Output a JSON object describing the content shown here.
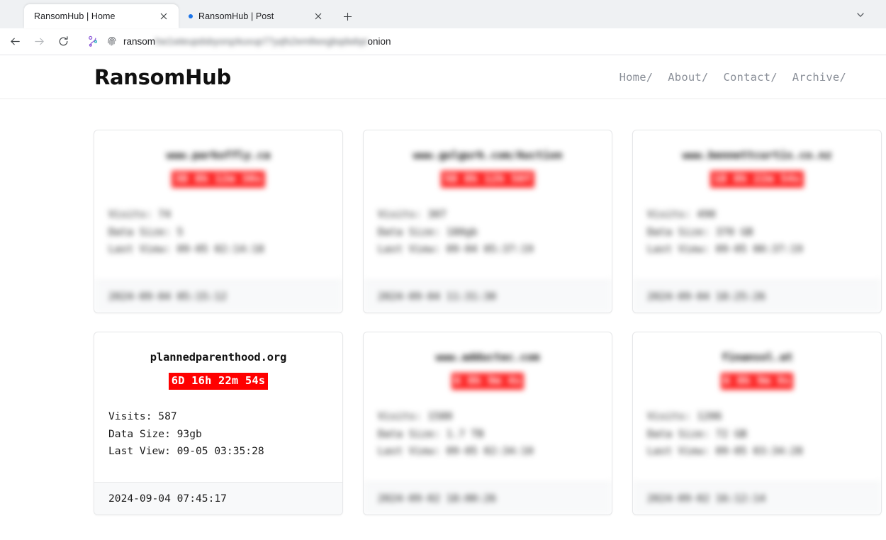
{
  "browser": {
    "tabs": [
      {
        "title": "RansomHub | Home",
        "active": true,
        "has_dot": false,
        "close_icon": "close-icon"
      },
      {
        "title": "RansomHub | Post",
        "active": false,
        "has_dot": true,
        "close_icon": "close-icon"
      }
    ],
    "new_tab_label": "+",
    "tab_list_icon": "chevron-down-icon",
    "toolbar": {
      "back_icon": "back-arrow-icon",
      "forward_icon": "forward-arrow-icon",
      "reload_icon": "reload-icon",
      "split_screen_icon": "split-screen-icon",
      "tracking_protection_icon": "fingerprint-icon"
    },
    "address_bar": {
      "url_prefix": "ransom",
      "url_redacted": "hw1wteupdsbyorqzkuvup77yqfs2em8wxgbqdwbpi",
      "url_suffix": "onion"
    }
  },
  "site": {
    "brand": "RansomHub",
    "nav": [
      {
        "label": "Home/"
      },
      {
        "label": "About/"
      },
      {
        "label": "Contact/"
      },
      {
        "label": "Archive/"
      }
    ]
  },
  "victims": [
    {
      "redacted": true,
      "domain": "www.parkoffly.ca",
      "countdown": "3D 8h 12m 30s",
      "visits": "Visits: 74",
      "data_size": "Data Size: 5",
      "last_view": "Last View: 09-05 02:14:18",
      "published": "2024-09-04 05:15:12"
    },
    {
      "redacted": true,
      "domain": "www.golgurk.com/Auction",
      "countdown": "5D 8h 12h 50f",
      "visits": "Visits: 307",
      "data_size": "Data Size: 180gb",
      "last_view": "Last View: 09-04 05:37:19",
      "published": "2024-09-04 11:31:30"
    },
    {
      "redacted": true,
      "domain": "www.bennettcurtis.co.nz",
      "countdown": "1D 8h 22m 54s",
      "visits": "Visits: 490",
      "data_size": "Data Size: 370 GB",
      "last_view": "Last View: 09-05 00:37:19",
      "published": "2024-09-04 18:25:26"
    },
    {
      "redacted": false,
      "domain": "plannedparenthood.org",
      "countdown": "6D 16h 22m 54s",
      "visits": "Visits: 587",
      "data_size": "Data Size: 93gb",
      "last_view": "Last View: 09-05 03:35:28",
      "published": "2024-09-04 07:45:17"
    },
    {
      "redacted": true,
      "domain": "www.adductec.com",
      "countdown": "6 8h 9m 4s",
      "visits": "Visits: 1580",
      "data_size": "Data Size: 1.7 TB",
      "last_view": "Last View: 09-05 02:34:10",
      "published": "2024-09-02 18:00:26"
    },
    {
      "redacted": true,
      "domain": "finansol.at",
      "countdown": "6 8h 9m 9s",
      "visits": "Visits: 1206",
      "data_size": "Data Size: 72 GB",
      "last_view": "Last View: 09-05 03:34:28",
      "published": "2024-09-02 16:12:14"
    }
  ],
  "colors": {
    "countdown_bg": "#ff0000",
    "countdown_fg": "#ffffff",
    "card_border": "#e6e7e9",
    "footer_bg": "#f8f9fa",
    "nav_link": "#8a8f98",
    "tab_dot": "#1a73e8"
  }
}
